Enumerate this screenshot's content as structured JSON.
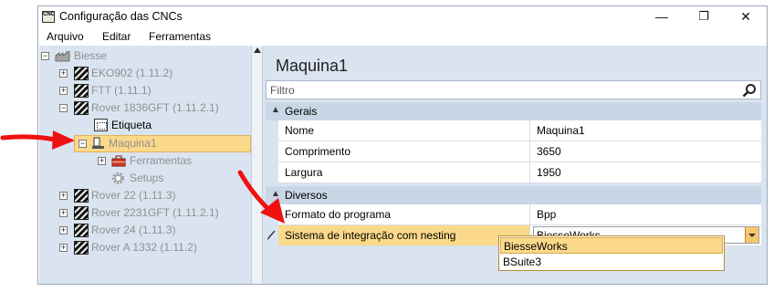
{
  "window": {
    "title": "Configuração das CNCs",
    "app_icon_text": "CNC",
    "minimize": "—",
    "maximize": "❐",
    "close": "✕"
  },
  "menu": [
    "Arquivo",
    "Editar",
    "Ferramentas"
  ],
  "tree": {
    "root": "Biesse",
    "items": [
      {
        "label": "EKO902 (1.11.2)",
        "expander": "+"
      },
      {
        "label": "FTT (1.11.1)",
        "expander": "+"
      },
      {
        "label": "Rover 1836GFT (1.11.2.1)",
        "expander": "−"
      },
      {
        "label": "Etiqueta"
      },
      {
        "label": "Maquina1",
        "expander": "−",
        "selected": true
      },
      {
        "label": "Ferramentas",
        "expander": "+"
      },
      {
        "label": "Setups"
      },
      {
        "label": "Rover 22 (1.11.3)",
        "expander": "+"
      },
      {
        "label": "Rover 2231GFT (1.11.2.1)",
        "expander": "+"
      },
      {
        "label": "Rover 24 (1.11.3)",
        "expander": "+"
      },
      {
        "label": "Rover A 1332 (1.11.2)",
        "expander": "+"
      }
    ]
  },
  "details": {
    "heading": "Maquina1",
    "filter_placeholder": "Filtro",
    "categories": {
      "gerais": "Gerais",
      "diversos": "Diversos"
    },
    "gerais_rows": [
      {
        "key": "Nome",
        "value": "Maquina1"
      },
      {
        "key": "Comprimento",
        "value": "3650"
      },
      {
        "key": "Largura",
        "value": "1950"
      }
    ],
    "diversos_rows": [
      {
        "key": "Formato do programa",
        "value": "Bpp"
      },
      {
        "key": "Sistema de integração com nesting",
        "value": "BiesseWorks"
      }
    ],
    "dropdown_options": [
      "BiesseWorks",
      "BSuite3"
    ]
  },
  "colors": {
    "annotation_arrow": "#ee1111",
    "selection": "#fbd98a",
    "pane_bg": "#dae4f0"
  }
}
